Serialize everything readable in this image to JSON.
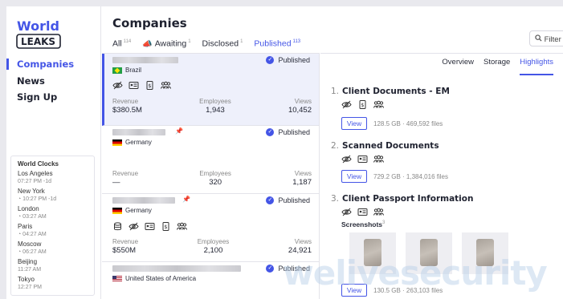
{
  "logo": {
    "line1": "World",
    "line2": "LEAKS"
  },
  "sidebar": {
    "items": [
      {
        "label": "Companies",
        "active": true
      },
      {
        "label": "News"
      },
      {
        "label": "Sign Up"
      }
    ],
    "clocks_title": "World Clocks",
    "clocks": [
      {
        "city": "Los Angeles",
        "time": "07:27 PM -1d"
      },
      {
        "city": "New York",
        "time": "◔ 10:27 PM -1d"
      },
      {
        "city": "London",
        "time": "◔ 03:27 AM"
      },
      {
        "city": "Paris",
        "time": "◔ 04:27 AM"
      },
      {
        "city": "Moscow",
        "time": "◔ 06:27 AM"
      },
      {
        "city": "Beijing",
        "time": "11:27 AM"
      },
      {
        "city": "Tokyo",
        "time": "12:27 PM"
      }
    ]
  },
  "header": {
    "title": "Companies",
    "tabs": [
      {
        "label": "All",
        "count": "114"
      },
      {
        "label": "Awaiting",
        "count": "1"
      },
      {
        "label": "Disclosed",
        "count": "1"
      },
      {
        "label": "Published",
        "count": "113",
        "active": true
      }
    ],
    "filter_label": "Filter"
  },
  "companies": [
    {
      "status": "Published",
      "country": "Brazil",
      "flag": "br",
      "revenue_label": "Revenue",
      "revenue": "$380.5M",
      "employees_label": "Employees",
      "employees": "1,943",
      "views_label": "Views",
      "views": "10,452"
    },
    {
      "status": "Published",
      "country": "Germany",
      "flag": "de",
      "revenue_label": "Revenue",
      "revenue": "—",
      "employees_label": "Employees",
      "employees": "320",
      "views_label": "Views",
      "views": "1,187"
    },
    {
      "status": "Published",
      "country": "Germany",
      "flag": "de",
      "revenue_label": "Revenue",
      "revenue": "$550M",
      "employees_label": "Employees",
      "employees": "2,100",
      "views_label": "Views",
      "views": "24,921"
    },
    {
      "status": "Published",
      "country": "United States of America",
      "flag": "us"
    }
  ],
  "detail": {
    "tabs": [
      {
        "label": "Overview"
      },
      {
        "label": "Storage"
      },
      {
        "label": "Highlights",
        "active": true
      }
    ],
    "items": [
      {
        "num": "1.",
        "title": "Client Documents - EM",
        "view": "View",
        "size": "128.5 GB",
        "files": "469,592 files"
      },
      {
        "num": "2.",
        "title": "Scanned Documents",
        "view": "View",
        "size": "729.2 GB",
        "files": "1,384,016 files"
      },
      {
        "num": "3.",
        "title": "Client Passport Information",
        "view": "View",
        "size": "130.5 GB",
        "files": "263,103 files",
        "screenshots_label": "Screenshots",
        "screenshots_count": "3"
      }
    ]
  },
  "watermark": "welivesecurity",
  "colors": {
    "accent": "#4455e6",
    "awaiting": "#e23b4e"
  }
}
